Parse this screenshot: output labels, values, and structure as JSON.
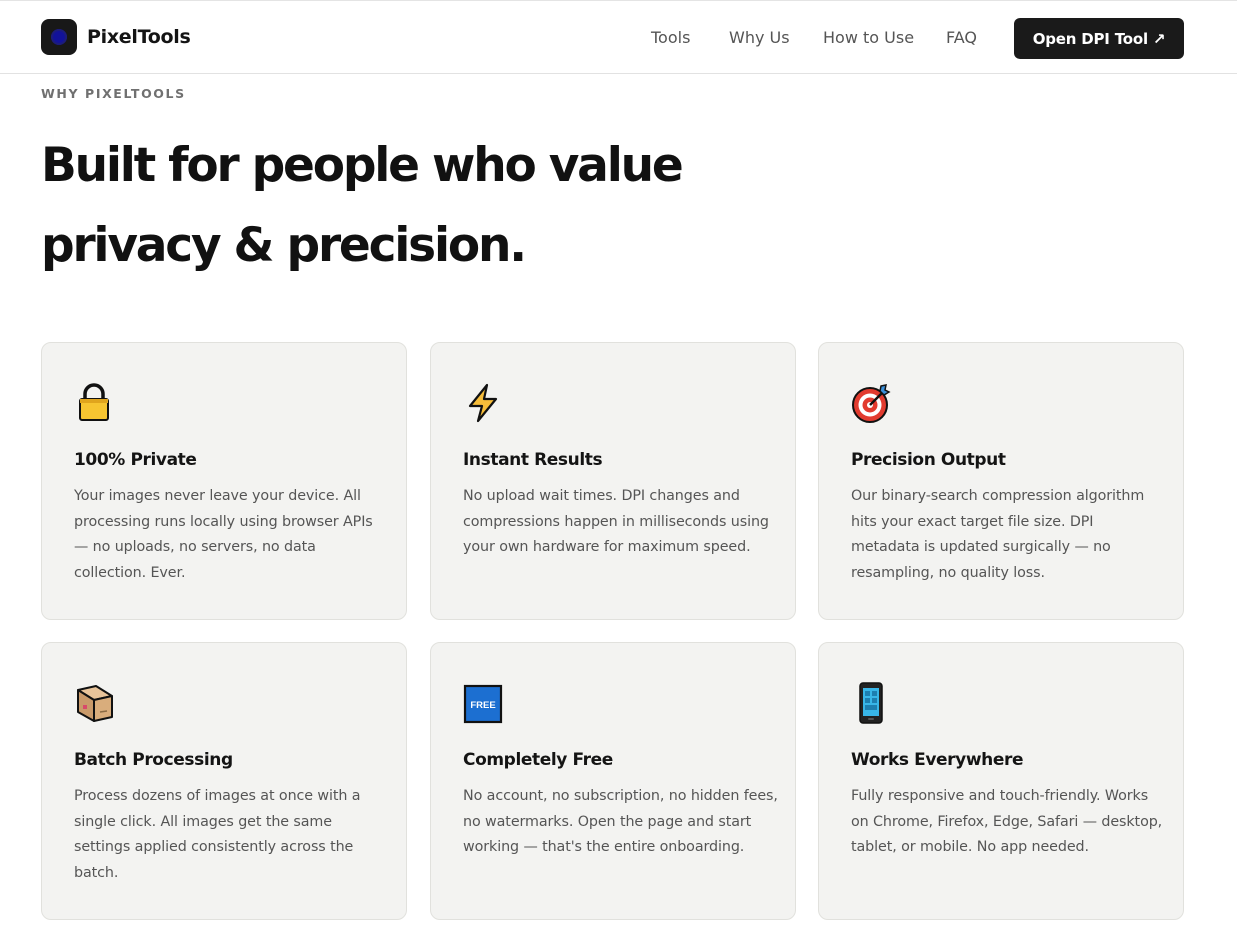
{
  "header": {
    "brand": "PixelTools",
    "nav": [
      "Tools",
      "Why Us",
      "How to Use",
      "FAQ"
    ],
    "cta": "Open DPI Tool ↗"
  },
  "hero": {
    "eyebrow": "WHY PIXELTOOLS",
    "headline": "Built for people who value privacy & precision."
  },
  "features": [
    {
      "icon": "lock-icon",
      "title": "100% Private",
      "text": "Your images never leave your device. All processing runs locally using browser APIs — no uploads, no servers, no data collection. Ever."
    },
    {
      "icon": "lightning-icon",
      "title": "Instant Results",
      "text": "No upload wait times. DPI changes and compressions happen in milliseconds using your own hardware for maximum speed."
    },
    {
      "icon": "target-icon",
      "title": "Precision Output",
      "text": "Our binary-search compression algorithm hits your exact target file size. DPI metadata is updated surgically — no resampling, no quality loss."
    },
    {
      "icon": "package-icon",
      "title": "Batch Processing",
      "text": "Process dozens of images at once with a single click. All images get the same settings applied consistently across the batch."
    },
    {
      "icon": "free-icon",
      "title": "Completely Free",
      "text": "No account, no subscription, no hidden fees, no watermarks. Open the page and start working — that's the entire onboarding.",
      "badge": "FREE"
    },
    {
      "icon": "phone-icon",
      "title": "Works Everywhere",
      "text": "Fully responsive and touch-friendly. Works on Chrome, Firefox, Edge, Safari — desktop, tablet, or mobile. No app needed."
    }
  ]
}
